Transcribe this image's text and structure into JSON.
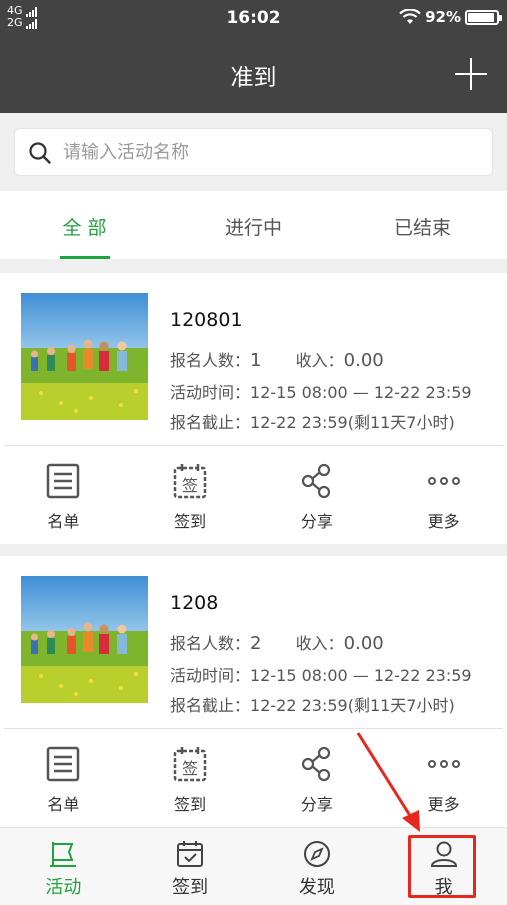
{
  "status_bar": {
    "network_1": "4G",
    "network_2": "2G",
    "time": "16:02",
    "battery": "92%",
    "battery_level": 0.92
  },
  "header": {
    "title": "准到",
    "add_icon": "plus-icon"
  },
  "search": {
    "placeholder": "请输入活动名称",
    "value": ""
  },
  "tabs": [
    {
      "label": "全 部",
      "active": true
    },
    {
      "label": "进行中",
      "active": false
    },
    {
      "label": "已结束",
      "active": false
    }
  ],
  "activities": [
    {
      "name": "120801",
      "signup_label": "报名人数：",
      "signup_count": "1",
      "income_label": "收入：",
      "income": "0.00",
      "time_label": "活动时间：",
      "time_range": "12-15 08:00 — 12-22 23:59",
      "deadline_label": "报名截止：",
      "deadline": "12-22 23:59(剩11天7小时)"
    },
    {
      "name": "1208",
      "signup_label": "报名人数：",
      "signup_count": "2",
      "income_label": "收入：",
      "income": "0.00",
      "time_label": "活动时间：",
      "time_range": "12-15 08:00 — 12-22 23:59",
      "deadline_label": "报名截止：",
      "deadline": "12-22 23:59(剩11天7小时)"
    }
  ],
  "card_actions": {
    "list": "名单",
    "checkin": "签到",
    "checkin_icon_char": "签",
    "share": "分享",
    "more": "更多"
  },
  "bottom_nav": [
    {
      "label": "活动",
      "icon": "flag-icon",
      "active": true
    },
    {
      "label": "签到",
      "icon": "calendar-check-icon",
      "active": false
    },
    {
      "label": "发现",
      "icon": "compass-icon",
      "active": false
    },
    {
      "label": "我",
      "icon": "person-icon",
      "active": false
    }
  ],
  "colors": {
    "accent": "#1fa33f",
    "header_bg": "#434343",
    "annotation": "#e8271f"
  }
}
